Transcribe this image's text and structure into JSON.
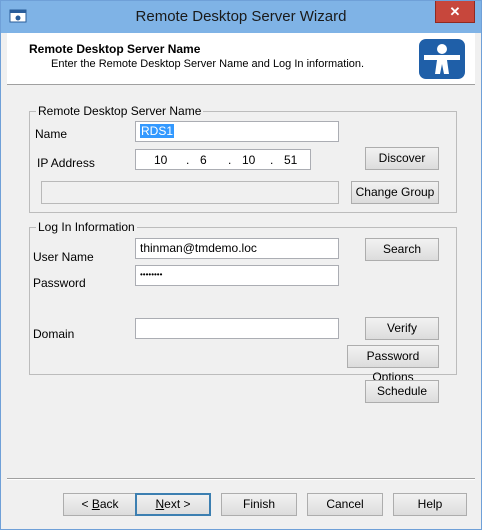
{
  "window": {
    "title": "Remote Desktop Server Wizard",
    "close_label": "✕"
  },
  "header": {
    "title": "Remote Desktop Server Name",
    "subtitle": "Enter the Remote Desktop Server Name and Log In information."
  },
  "server_group": {
    "title": "Remote Desktop Server Name",
    "name_label": "Name",
    "name_value": "RDS1",
    "ip_label": "IP Address",
    "ip_octets": [
      "10",
      "6",
      "10",
      "51"
    ],
    "group_value": "",
    "discover_button": "Discover",
    "change_group_button": "Change Group"
  },
  "login_group": {
    "title": "Log In Information",
    "username_label": "User Name",
    "username_value": "thinman@tmdemo.loc",
    "password_label": "Password",
    "password_value": "••••••••",
    "domain_label": "Domain",
    "domain_value": "",
    "search_button": "Search",
    "verify_button": "Verify",
    "password_options_button": "Password Options"
  },
  "schedule_button": "Schedule",
  "footer": {
    "back_prefix": "< ",
    "back_mnemonic": "B",
    "back_rest": "ack",
    "next_mnemonic": "N",
    "next_rest": "ext >",
    "finish": "Finish",
    "cancel": "Cancel",
    "help": "Help"
  },
  "colors": {
    "titlebar": "#7fb3e6",
    "close": "#c7473c",
    "selection": "#3399ff",
    "logo": "#1f5fa8"
  },
  "icons": {
    "title": "wizard-icon",
    "logo": "thinmanager-logo-icon"
  }
}
